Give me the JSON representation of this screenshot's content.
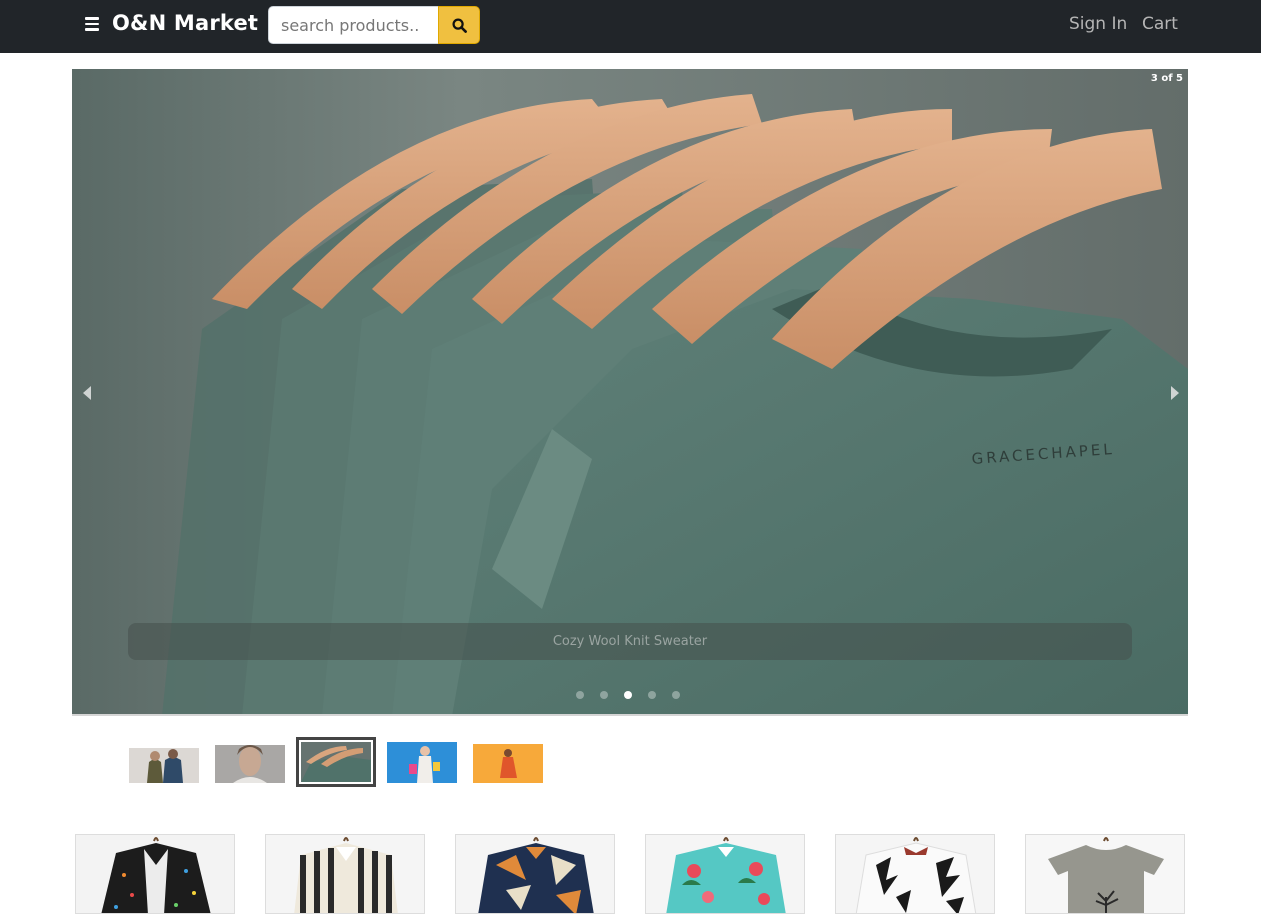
{
  "navbar": {
    "brand": "O&N Market",
    "search_placeholder": "search products..",
    "signin_label": "Sign In",
    "cart_label": "Cart",
    "search_button_color": "#f0c040",
    "background_color": "#212529"
  },
  "carousel": {
    "counter": "3 of 5",
    "caption": "Cozy Wool Knit Sweater",
    "current_slide": 3,
    "total_slides": 5,
    "photo_label_text": "GRACECHAPEL"
  },
  "thumbnails": [
    {
      "name": "couple-jackets",
      "selected": false
    },
    {
      "name": "woman-portrait",
      "selected": false
    },
    {
      "name": "green-shirts-on-hangers",
      "selected": true
    },
    {
      "name": "woman-shopping-bags-blue",
      "selected": false
    },
    {
      "name": "woman-orange-background",
      "selected": false
    }
  ],
  "products": [
    {
      "name": "black-printed-shirt"
    },
    {
      "name": "striped-shirt"
    },
    {
      "name": "geometric-print-shirt"
    },
    {
      "name": "tropical-floral-shirt"
    },
    {
      "name": "palm-print-shirt"
    },
    {
      "name": "gray-tree-tshirt"
    }
  ]
}
